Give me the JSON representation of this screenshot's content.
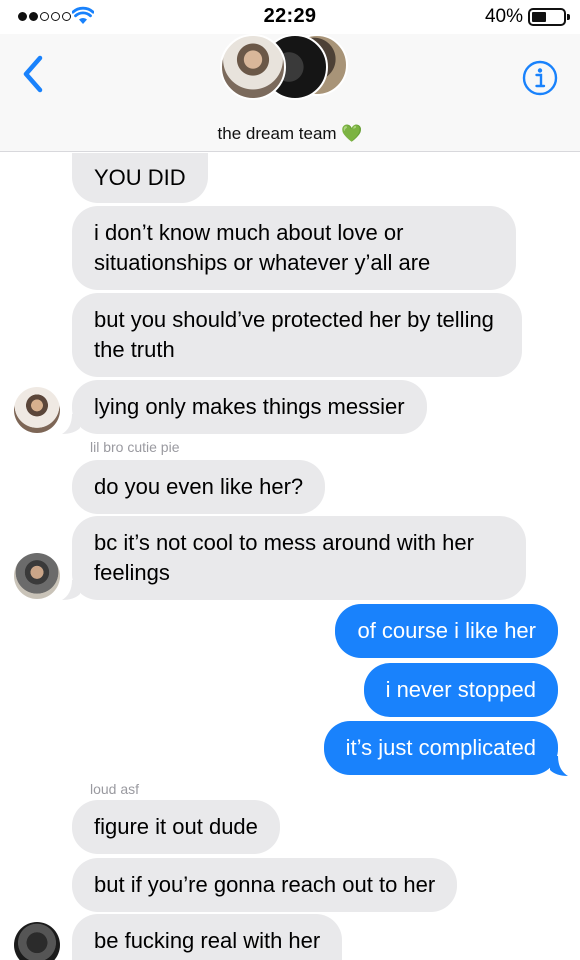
{
  "status_bar": {
    "time": "22:29",
    "battery_percent": "40%",
    "signal_bars": 2,
    "battery_level": 0.4
  },
  "header": {
    "group_name": "the dream team",
    "heart_emoji": "💚",
    "back_icon": "chevron-left-icon",
    "info_icon": "info-circle-icon"
  },
  "colors": {
    "outgoing_bubble": "#1982fc",
    "incoming_bubble": "#e9e9eb",
    "accent": "#1982fc"
  },
  "messages": [
    {
      "direction": "in",
      "text": "YOU DID"
    },
    {
      "direction": "in",
      "text": "i don’t know much about love or situationships or whatever y’all are"
    },
    {
      "direction": "in",
      "text": "but you should’ve protected her by telling the truth"
    },
    {
      "direction": "in",
      "text": "lying only makes things messier"
    },
    {
      "direction": "label",
      "text": "lil bro cutie pie"
    },
    {
      "direction": "in",
      "text": "do you even like her?"
    },
    {
      "direction": "in",
      "text": "bc it’s not cool to mess around with her feelings"
    },
    {
      "direction": "out",
      "text": "of course i like her"
    },
    {
      "direction": "out",
      "text": "i never stopped"
    },
    {
      "direction": "out",
      "text": "it’s just complicated"
    },
    {
      "direction": "label",
      "text": "loud asf"
    },
    {
      "direction": "in",
      "text": "figure it out dude"
    },
    {
      "direction": "in",
      "text": "but if you’re gonna reach out to her"
    },
    {
      "direction": "in",
      "text": "be fucking real with her"
    }
  ]
}
